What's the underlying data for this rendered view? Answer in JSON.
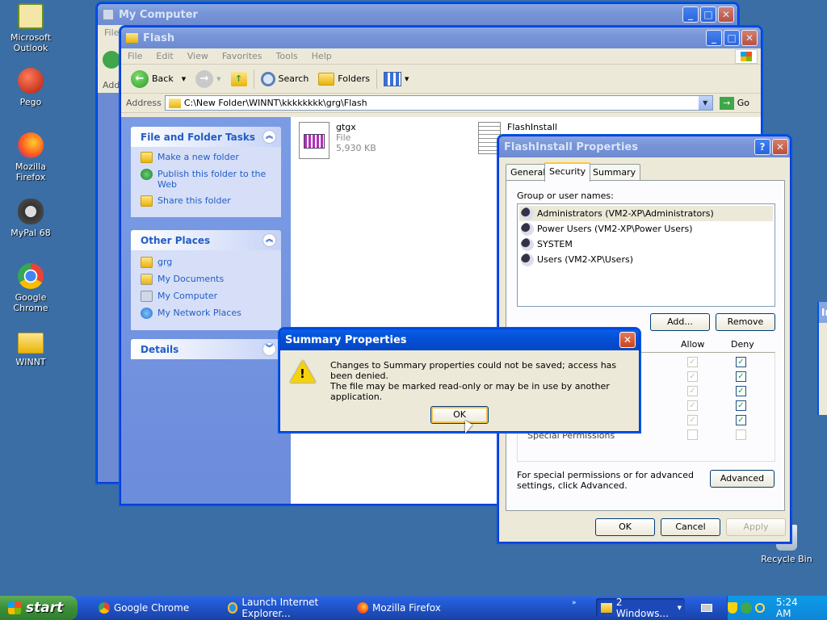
{
  "desktop": {
    "icons": [
      {
        "label": "Microsoft Outlook",
        "icon": "outlook-icon"
      },
      {
        "label": "Pego",
        "icon": "pego-icon"
      },
      {
        "label": "Mozilla Firefox",
        "icon": "firefox-icon"
      },
      {
        "label": "MyPal 68",
        "icon": "mypal-icon"
      },
      {
        "label": "Google Chrome",
        "icon": "chrome-icon"
      },
      {
        "label": "WINNT",
        "icon": "folder-icon"
      },
      {
        "label": "Recycle Bin",
        "icon": "recycle-bin-icon"
      }
    ]
  },
  "my_computer": {
    "title": "My Computer",
    "menu_fragment": "File",
    "addr_fragment": "Add"
  },
  "explorer": {
    "title": "Flash",
    "menu": [
      "File",
      "Edit",
      "View",
      "Favorites",
      "Tools",
      "Help"
    ],
    "toolbar": {
      "back": "Back",
      "search": "Search",
      "folders": "Folders"
    },
    "address_label": "Address",
    "address_value": "C:\\New Folder\\WINNT\\kkkkkkkk\\grg\\Flash",
    "go_label": "Go",
    "tasks": {
      "file_folder_title": "File and Folder Tasks",
      "file_folder_items": [
        "Make a new folder",
        "Publish this folder to the Web",
        "Share this folder"
      ],
      "other_places_title": "Other Places",
      "other_places_items": [
        "grg",
        "My Documents",
        "My Computer",
        "My Network Places"
      ],
      "details_title": "Details"
    },
    "files": [
      {
        "name": "gtgx",
        "type": "File",
        "size": "5,930 KB"
      },
      {
        "name": "FlashInstall"
      }
    ]
  },
  "props": {
    "title": "FlashInstall Properties",
    "help_btn": "?",
    "tabs": [
      "General",
      "Security",
      "Summary"
    ],
    "active_tab": "Security",
    "group_label": "Group or user names:",
    "users": [
      "Administrators (VM2-XP\\Administrators)",
      "Power Users (VM2-XP\\Power Users)",
      "SYSTEM",
      "Users (VM2-XP\\Users)"
    ],
    "add_btn": "Add...",
    "remove_btn": "Remove",
    "allow_label": "Allow",
    "deny_label": "Deny",
    "special_perm": "Special Permissions",
    "special_note": "For special permissions or for advanced settings, click Advanced.",
    "advanced_btn": "Advanced",
    "ok_btn": "OK",
    "cancel_btn": "Cancel",
    "apply_btn": "Apply"
  },
  "summary_dialog": {
    "title": "Summary Properties",
    "message1": "Changes to Summary properties could not be saved; access has been denied.",
    "message2": "The file may be marked read-only or may be in use by another application.",
    "ok_btn": "OK"
  },
  "partial_window": {
    "title_fragment": "In"
  },
  "taskbar": {
    "start": "start",
    "buttons": [
      "Google Chrome",
      "Launch Internet Explorer...",
      "Mozilla Firefox"
    ],
    "group_button": "2 Windows...",
    "clock": "5:24 AM"
  },
  "colors": {
    "desktop": "#3a6ea5",
    "titlebar": "#0451d6",
    "link": "#215dc6"
  }
}
